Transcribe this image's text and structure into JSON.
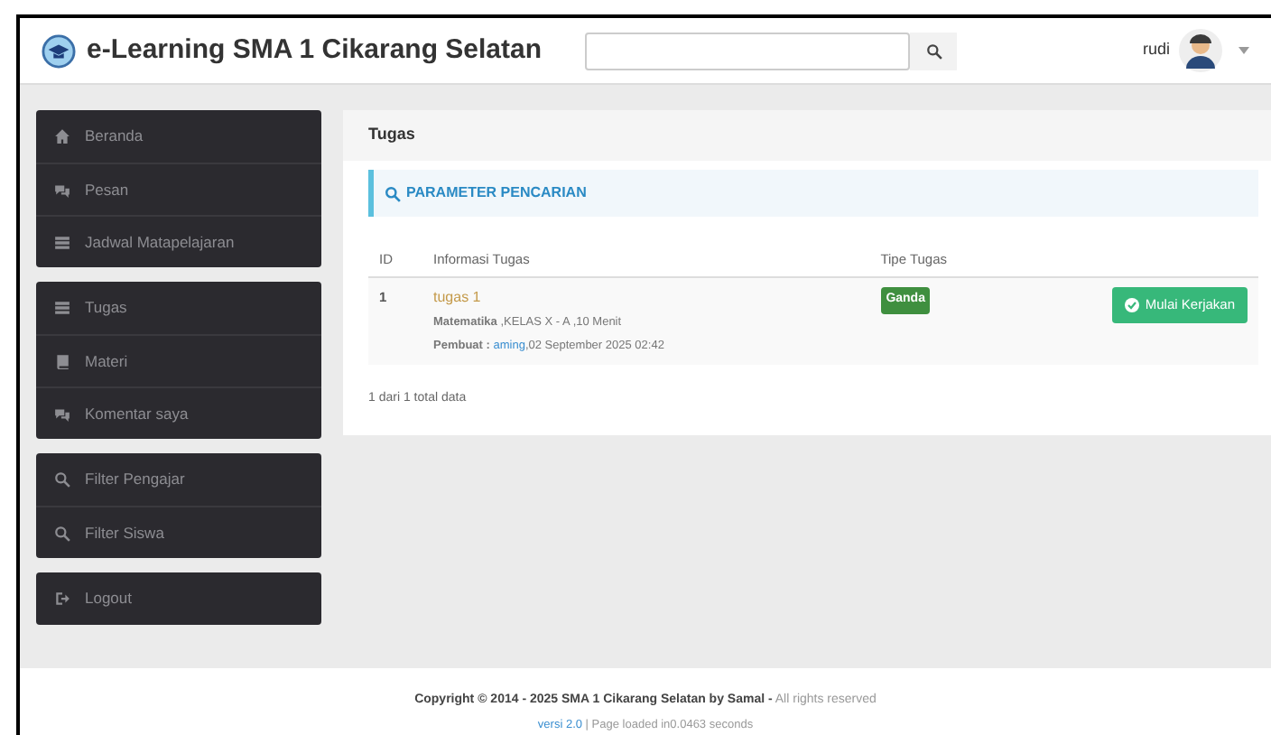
{
  "header": {
    "title": "e-Learning SMA 1 Cikarang Selatan",
    "user": "rudi"
  },
  "sidebar": {
    "groups": [
      {
        "items": [
          {
            "label": "Beranda"
          },
          {
            "label": "Pesan"
          },
          {
            "label": "Jadwal Matapelajaran"
          }
        ]
      },
      {
        "items": [
          {
            "label": "Tugas"
          },
          {
            "label": "Materi"
          },
          {
            "label": "Komentar saya"
          }
        ]
      },
      {
        "items": [
          {
            "label": "Filter Pengajar"
          },
          {
            "label": "Filter Siswa"
          }
        ]
      },
      {
        "items": [
          {
            "label": "Logout"
          }
        ]
      }
    ]
  },
  "panel": {
    "title": "Tugas",
    "search_box": "PARAMETER PENCARIAN",
    "table": {
      "columns": [
        "ID",
        "Informasi Tugas",
        "Tipe Tugas"
      ],
      "rows": [
        {
          "id": "1",
          "title": "tugas 1",
          "details": "**Matematika** ,KELAS X - A ,10 Menit",
          "author_label": "Pembuat :",
          "author": "aming",
          "date": ",02 September 2025 02:42",
          "type": "Ganda",
          "action": "Mulai Kerjakan"
        }
      ]
    },
    "summary": "1 dari 1 total data"
  },
  "footer": {
    "copyright": "**Copyright © 2014 - 2025 SMA 1 Cikarang Selatan by Samal -** All rights reserved",
    "version": "versi 2.0",
    "load_info": "| Page loaded in0.0463 seconds"
  }
}
